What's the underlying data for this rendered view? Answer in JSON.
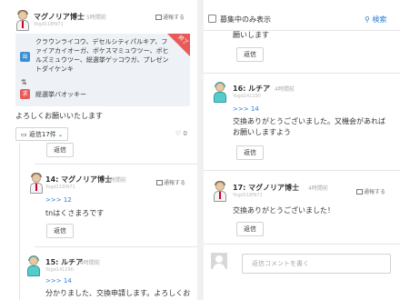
{
  "left": {
    "post": {
      "user": "マグノリア博士",
      "ago": "5時間前",
      "uid": "Yogd118f971",
      "report": "通報する",
      "trade": {
        "status": "終了",
        "give_badge": "出",
        "get_badge": "求",
        "give_text": "クラウンライコウ、デセルシティパルキア、ファイアカイオーガ、ボケスマミュウツー、ボヒルズミュウツー、総選挙ゲッコウガ、プレゼントダイケンキ",
        "get_text": "総選挙バオッキー",
        "badge_colors": {
          "give": "#3b8fd3",
          "get": "#e85a5a"
        }
      },
      "message": "よろしくお願いいたします",
      "replies_label": "返信17件",
      "like_count": "0"
    },
    "reply_button_top": "返信",
    "comment14": {
      "user": "マグノリア博士",
      "ago": "4時間前",
      "uid": "Yogd118f971",
      "report": "通報する",
      "anchor": ">>> 12",
      "text": "tnはくさまろです",
      "reply": "返信"
    },
    "comment15": {
      "user": "ルチア",
      "ago": "4時間前",
      "uid": "Yogd141190",
      "anchor": ">>> 14",
      "text": "分かりました、交換申請します。よろしくお"
    }
  },
  "right": {
    "filter_label": "募集中のみ表示",
    "search_label": "検索",
    "top_snippet": "願いします",
    "top_reply": "返信",
    "comment16": {
      "user": "16: ルチア",
      "ago": "4時間前",
      "uid": "Yogd141190",
      "anchor": ">>> 14",
      "text": "交換ありがとうございました。又機会があればお願いしますよう",
      "reply": "返信"
    },
    "comment17": {
      "user": "17: マグノリア博士",
      "ago": "4時間前",
      "uid": "Yogd118f971",
      "report": "通報する",
      "text": "交換ありがとうございました！",
      "reply": "返信"
    },
    "reply_placeholder": "返信コメントを書く"
  }
}
